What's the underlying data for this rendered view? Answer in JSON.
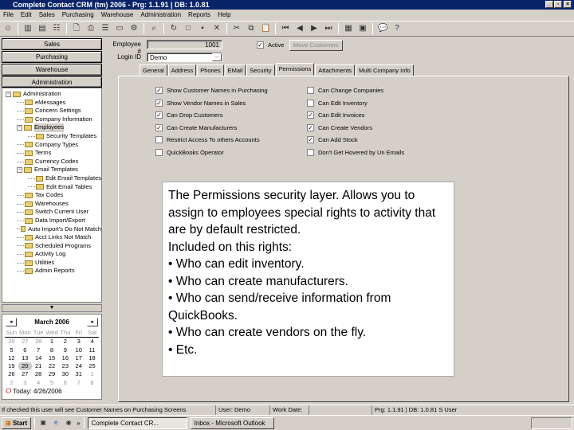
{
  "window": {
    "title": "Complete Contact CRM (tm) 2006 - Prg: 1.1.91 | DB: 1.0.81"
  },
  "menu": [
    "File",
    "Edit",
    "Sales",
    "Purchasing",
    "Warehouse",
    "Administration",
    "Reports",
    "Help"
  ],
  "nav": {
    "sales": "Sales",
    "purchasing": "Purchasing",
    "warehouse": "Warehouse",
    "administration": "Administration"
  },
  "tree": [
    {
      "label": "Administration",
      "level": 0,
      "expander": "−"
    },
    {
      "label": "eMessages",
      "level": 1
    },
    {
      "label": "Concern Settings",
      "level": 1
    },
    {
      "label": "Company Information",
      "level": 1
    },
    {
      "label": "Employees",
      "level": 1,
      "expander": "−",
      "selected": true
    },
    {
      "label": "Security Templates",
      "level": 2
    },
    {
      "label": "Company Types",
      "level": 1
    },
    {
      "label": "Terms",
      "level": 1
    },
    {
      "label": "Currency Codes",
      "level": 1
    },
    {
      "label": "Email Templates",
      "level": 1,
      "expander": "−"
    },
    {
      "label": "Edit Email Templates",
      "level": 2
    },
    {
      "label": "Edit Email Tables",
      "level": 2
    },
    {
      "label": "Tax Codes",
      "level": 1
    },
    {
      "label": "Warehouses",
      "level": 1
    },
    {
      "label": "Switch Current User",
      "level": 1
    },
    {
      "label": "Data Import/Export",
      "level": 1
    },
    {
      "label": "Auto Import's Do Not Match",
      "level": 1
    },
    {
      "label": "Acct Links Not Match",
      "level": 1
    },
    {
      "label": "Scheduled Programs",
      "level": 1
    },
    {
      "label": "Activity Log",
      "level": 1
    },
    {
      "label": "Utilities",
      "level": 1
    },
    {
      "label": "Admin Reports",
      "level": 1
    }
  ],
  "calendar": {
    "title": "March 2006",
    "days": [
      "Sun",
      "Mon",
      "Tue",
      "Wed",
      "Thu",
      "Fri",
      "Sat"
    ],
    "weeks": [
      [
        "26",
        "27",
        "28",
        "1",
        "2",
        "3",
        "4"
      ],
      [
        "5",
        "6",
        "7",
        "8",
        "9",
        "10",
        "11"
      ],
      [
        "12",
        "13",
        "14",
        "15",
        "16",
        "17",
        "18"
      ],
      [
        "19",
        "20",
        "21",
        "22",
        "23",
        "24",
        "25"
      ],
      [
        "26",
        "27",
        "28",
        "29",
        "30",
        "31",
        "1"
      ],
      [
        "2",
        "3",
        "4",
        "5",
        "6",
        "7",
        "8"
      ]
    ],
    "today": "Today: 4/26/2006"
  },
  "form": {
    "employee_label": "Employee #",
    "employee_value": "1001",
    "login_label": "Login ID",
    "login_value": "Demo",
    "browse": "...",
    "active_label": "Active",
    "move_customers": "Move Customers"
  },
  "tabs": [
    "General",
    "Address",
    "Phones",
    "EMail",
    "Security",
    "Permissions",
    "Attachments",
    "Multi Company Info"
  ],
  "permissions": {
    "left": [
      {
        "label": "Show Customer Names in Purchasing",
        "checked": true
      },
      {
        "label": "Show Vendor Names in Sales",
        "checked": true
      },
      {
        "label": "Can Drop Customers",
        "checked": true
      },
      {
        "label": "Can Create Manufacturers",
        "checked": true
      },
      {
        "label": "Restrict Access To others Accounts",
        "checked": false
      },
      {
        "label": "QuickBooks Operator",
        "checked": false
      }
    ],
    "right": [
      {
        "label": "Can Change Companies",
        "checked": false
      },
      {
        "label": "Can Edit Inventory",
        "checked": false
      },
      {
        "label": "Can Edit Invoices",
        "checked": true
      },
      {
        "label": "Can Create Vendors",
        "checked": true
      },
      {
        "label": "Can Add Stock",
        "checked": true
      },
      {
        "label": "Don't Get Hovered by Un Emails",
        "checked": false
      }
    ]
  },
  "note": [
    "The Permissions security layer. Allows you to assign to employees special rights to activity that are by default restricted.",
    "Included on this rights:",
    "• Who can edit inventory.",
    "• Who can create manufacturers.",
    "• Who can send/receive information from QuickBooks.",
    "• Who can create vendors on the fly.",
    "• Etc."
  ],
  "status": {
    "hint": "If checked this user will see Customer Names on Purchasing Screens",
    "user": "User: Demo",
    "work_date": "Work Date:",
    "version": "Prg: 1.1.91 | DB: 1.0.81 S User"
  },
  "taskbar": {
    "start": "Start",
    "chevron": "»",
    "items": [
      "Complete Contact CR...",
      "Inbox - Microsoft Outlook"
    ]
  }
}
